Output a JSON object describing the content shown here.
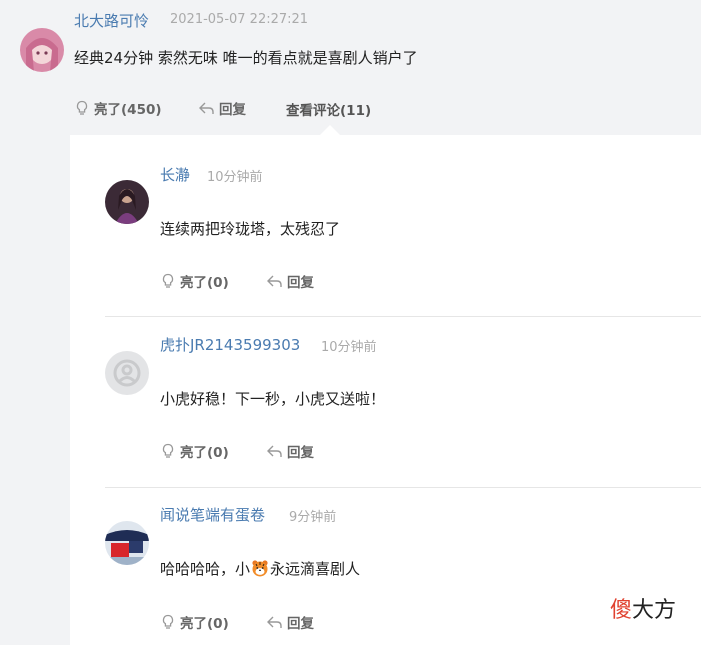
{
  "top_comment": {
    "username": "北大路可怜",
    "timestamp": "2021-05-07 22:27:21",
    "content": "经典24分钟 索然无味 唯一的看点就是喜剧人销户了",
    "like_label": "亮了(450)",
    "reply_label": "回复",
    "view_comments_label": "查看评论(11)"
  },
  "replies": [
    {
      "username": "长瀞",
      "timestamp": "10分钟前",
      "content": "连续两把玲珑塔，太残忍了",
      "like_label": "亮了(0)",
      "reply_label": "回复"
    },
    {
      "username": "虎扑JR2143599303",
      "timestamp": "10分钟前",
      "content": "小虎好稳！下一秒，小虎又送啦！",
      "like_label": "亮了(0)",
      "reply_label": "回复"
    },
    {
      "username": "闻说笔端有蛋卷",
      "timestamp": "9分钟前",
      "content_before": "哈哈哈哈，小",
      "content_emoji": "tiger-emoji",
      "content_after": "永远滴喜剧人",
      "like_label": "亮了(0)",
      "reply_label": "回复"
    }
  ],
  "watermark": {
    "part1": "傻",
    "part2": "大方"
  }
}
